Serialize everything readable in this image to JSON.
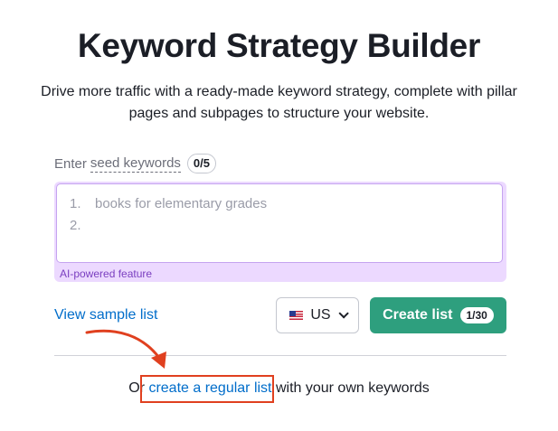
{
  "title": "Keyword Strategy Builder",
  "subtitle": "Drive more traffic with a ready-made keyword strategy, complete with pillar pages and subpages to structure your website.",
  "seed": {
    "prefix": "Enter",
    "link_text": "seed keywords",
    "counter": "0/5"
  },
  "keywords_input": {
    "lines": [
      {
        "num": "1.",
        "placeholder": "books for elementary grades"
      },
      {
        "num": "2.",
        "placeholder": ""
      }
    ],
    "ai_label": "AI-powered feature"
  },
  "actions": {
    "sample_link": "View sample list",
    "country": "US",
    "create_label": "Create list",
    "create_count": "1/30"
  },
  "bottom": {
    "prefix": "Or",
    "link": "create a regular list",
    "suffix": "with your own keywords"
  },
  "colors": {
    "primary_button": "#2e9f7e",
    "link": "#006dca",
    "ai_bg": "#ecd9ff",
    "annotation": "#e0401f"
  },
  "icons": {
    "flag": "us-flag-icon",
    "chevron": "chevron-down-icon",
    "annotation_arrow": "red-arrow-annotation"
  }
}
